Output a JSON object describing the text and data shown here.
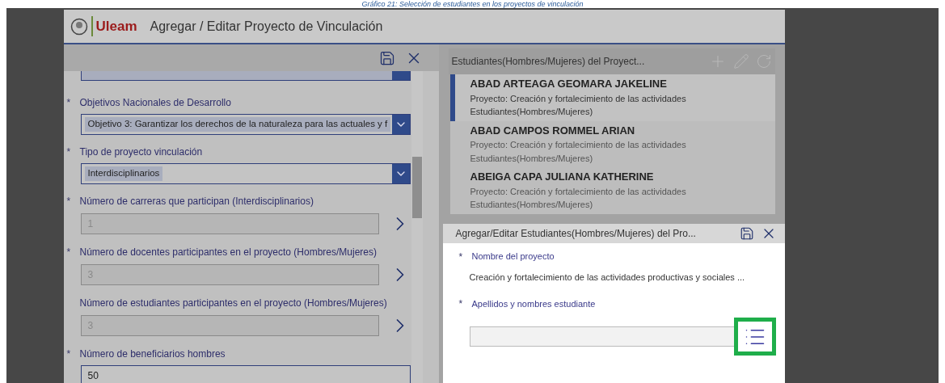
{
  "caption": "Gráfico 21: Selección de estudiantes en los proyectos de vinculación",
  "app": {
    "logo": "Uleam",
    "title": "Agregar / Editar Proyecto de Vinculación"
  },
  "form": {
    "fields": [
      {
        "kind": "dropdown",
        "marker": "*",
        "label": "Objetivos Nacionales de Desarrollo",
        "value": "Objetivo 3: Garantizar los derechos de la naturaleza para las actuales y f"
      },
      {
        "kind": "dropdown",
        "marker": "*",
        "label": "Tipo de proyecto vinculación",
        "value": "Interdisciplinarios"
      },
      {
        "kind": "linked",
        "marker": "*",
        "disabled": true,
        "label": "Número de carreras que participan (Interdisciplinarios)",
        "value": "1"
      },
      {
        "kind": "linked",
        "marker": "*",
        "disabled": true,
        "label": "Número de docentes participantes en el proyecto (Hombres/Mujeres)",
        "value": "3"
      },
      {
        "kind": "linked",
        "disabled": true,
        "label": "Número de estudiantes participantes en el proyecto (Hombres/Mujeres)",
        "value": "3"
      },
      {
        "kind": "text",
        "marker": "*",
        "disabled": false,
        "label": "Número de beneficiarios hombres",
        "value": "50"
      }
    ]
  },
  "list": {
    "title": "Estudiantes(Hombres/Mujeres) del Proyect...",
    "items": [
      {
        "name": "ABAD ARTEAGA GEOMARA JAKELINE",
        "line1": "Proyecto: Creación y fortalecimiento de las actividades",
        "line2": "Estudiantes(Hombres/Mujeres)",
        "selected": true
      },
      {
        "name": "ABAD CAMPOS ROMMEL ARIAN",
        "line1": "Proyecto: Creación y fortalecimiento de las actividades",
        "line2": "Estudiantes(Hombres/Mujeres)",
        "selected": false
      },
      {
        "name": "ABEIGA CAPA JULIANA KATHERINE",
        "line1": "Proyecto: Creación y fortalecimiento de las actividades",
        "line2": "Estudiantes(Hombres/Mujeres)",
        "selected": false
      }
    ]
  },
  "dialog": {
    "title": "Agregar/Editar Estudiantes(Hombres/Mujeres) del Pro...",
    "fields": [
      {
        "kind": "readonly",
        "marker": "*",
        "label": "Nombre del proyecto",
        "value": "Creación y fortalecimiento de las actividades productivas y sociales ..."
      },
      {
        "kind": "lookup",
        "marker": "*",
        "label": "Apellidos y nombres estudiante"
      }
    ]
  }
}
